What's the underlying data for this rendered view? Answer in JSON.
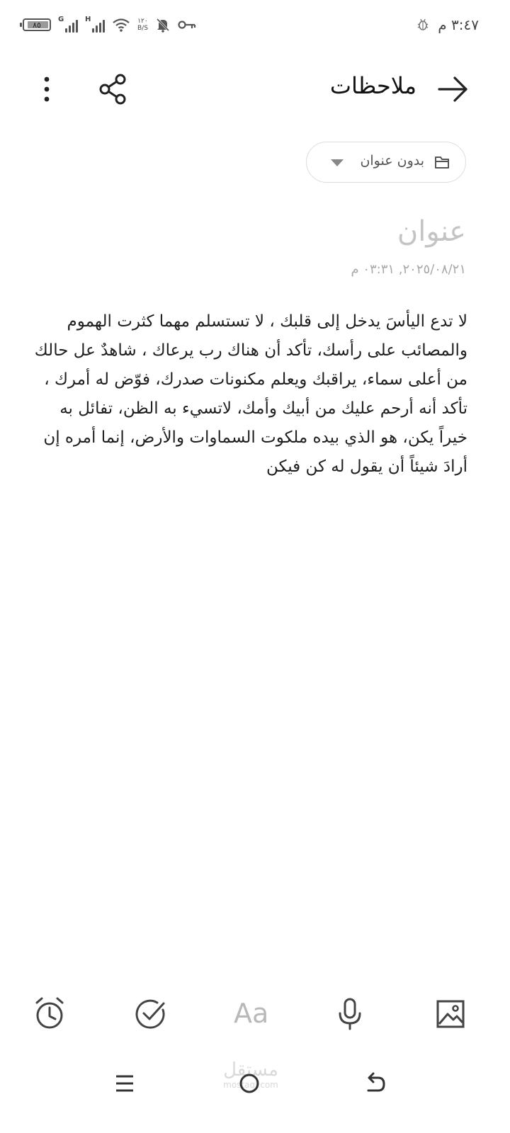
{
  "status_bar": {
    "time": "٣:٤٧ م",
    "battery_level": "٨٥",
    "network_1": "G",
    "network_2": "H",
    "speed_value": "١٢٠",
    "speed_unit": "B/S"
  },
  "header": {
    "title": "ملاحظات"
  },
  "folder_chip": {
    "label": "بدون عنوان"
  },
  "note": {
    "title_placeholder": "عنوان",
    "date": "٢٠٢٥/٠٨/٢١, ٠٣:٣١ م",
    "body_lines": [
      "لا تدع اليأسَ يدخل إلى قلبك ، لا تستسلم مهما كثرت الهموم",
      "والمصائب على رأسك، تأكد أن هناك رب يرعاك ، شاهدٌ عل حالك",
      "من أعلى سماء، يراقبك ويعلم مكنونات صدرك، فوّض له أمرك ،",
      "تأكد أنه أرحم عليك من أبيك وأمك، لاتسيء به الظن، تفائل به",
      "خيراً يكن، هو الذي بيده ملكوت السماوات والأرض، إنما أمره إن",
      "أرادَ شيئاً أن يقول له كن فيكن"
    ]
  },
  "toolbar": {
    "text_format_label": "Aa",
    "items": [
      "alarm-icon",
      "checkmark-icon",
      "text-format",
      "microphone-icon",
      "image-icon"
    ]
  },
  "watermark": {
    "arabic": "مستقل",
    "latin": "mostaql.com"
  },
  "colors": {
    "body_text": "#1f1f1f",
    "placeholder": "#c4c4c4",
    "icon": "#444444",
    "chip_border": "#dddddd"
  }
}
